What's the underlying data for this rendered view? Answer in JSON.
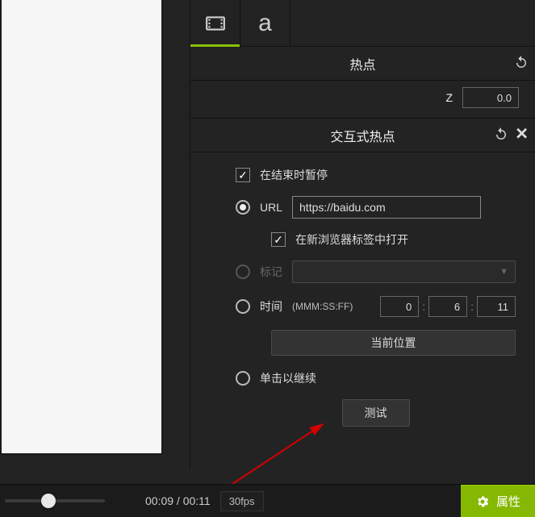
{
  "tabs": {
    "video": "video",
    "text": "a"
  },
  "sections": {
    "hotspot_title": "热点",
    "interactive_title": "交互式热点"
  },
  "z": {
    "label": "Z",
    "value": "0.0"
  },
  "form": {
    "pause_at_end_label": "在结束时暂停",
    "url_label": "URL",
    "url_value": "https://baidu.com",
    "open_new_tab_label": "在新浏览器标签中打开",
    "marker_label": "标记",
    "time_label": "时间",
    "time_hint": "(MMM:SS:FF)",
    "time_mm": "0",
    "time_ss": "6",
    "time_ff": "11",
    "current_position_label": "当前位置",
    "click_to_continue_label": "单击以继续",
    "test_label": "测试"
  },
  "footer": {
    "time_readout": "00:09 / 00:11",
    "fps": "30fps",
    "properties_label": "属性"
  }
}
